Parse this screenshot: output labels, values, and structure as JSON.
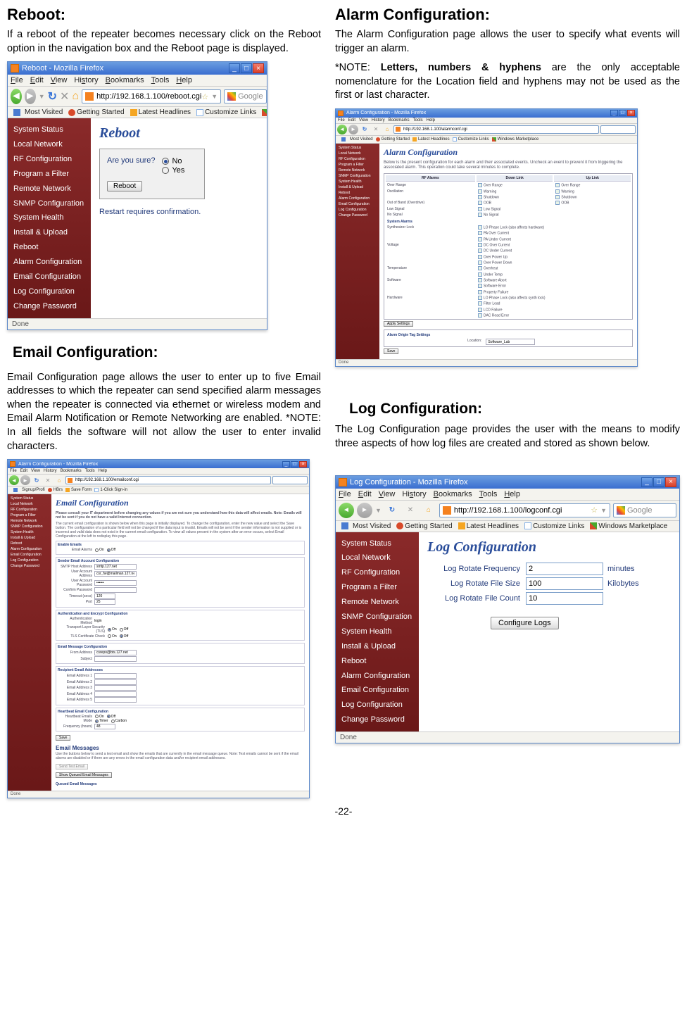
{
  "pageNumber": "-22-",
  "reboot": {
    "heading": "Reboot:",
    "text": "If a reboot of the repeater becomes necessary click on the Reboot option in the navigation box and the Reboot page is displayed.",
    "window": {
      "title": "Reboot - Mozilla Firefox",
      "url": "http://192.168.1.100/reboot.cgi",
      "search": "Google",
      "status": "Done",
      "appHeading": "Reboot",
      "question": "Are you sure?",
      "optNo": "No",
      "optYes": "Yes",
      "button": "Reboot",
      "confirm": "Restart requires confirmation."
    }
  },
  "alarm": {
    "heading": "Alarm Configuration:",
    "text": "The Alarm Configuration page allows the user to specify what events will trigger an alarm.",
    "notePrefix": "*NOTE:  ",
    "noteBold": "Letters, numbers & hyphens",
    "noteRest": " are the only acceptable nomenclature for the Location field and hyphens may not be used as the first or last character.",
    "window": {
      "title": "Alarm Configuration - Mozilla Firefox",
      "url": "http://192.168.1.100/alarmconf.cgi",
      "appHeading": "Alarm Configuration",
      "intro": "Below is the present configuration for each alarm and their associated events. Uncheck an event to prevent it from triggering the associated alarm. This operation could take several minutes to complete.",
      "colAlarm": "RF Alarms",
      "colDown": "Down Link",
      "colUp": "Up Link",
      "rows": {
        "overRange": "Over Range",
        "overRangeA": "Over Range",
        "overRangeB": "Over Range",
        "oscillation": "Oscillation",
        "oscillationA": "Warning",
        "oscillationB": "Warning",
        "oscillationC": "Shutdown",
        "oscillationD": "Shutdown",
        "outOfBand": "Out of Band (Overdrive)",
        "outOfBandA": "OOB",
        "outOfBandB": "OOB",
        "lowSignal": "Low Signal",
        "lowSignalA": "Low Signal",
        "noSignal": "No Signal",
        "noSignalA": "No Signal",
        "sysAlarms": "System Alarms",
        "synthLock": "Synthesizer Lock",
        "synth1": "LO Phase Lock (also affects hardware)",
        "synth2": "PA Over Current",
        "synth3": "PA Under Current",
        "voltage": "Voltage",
        "volt1": "DC Over Current",
        "volt2": "DC Under Current",
        "volt3": "Over Power Up",
        "volt4": "Over Power Down",
        "temperature": "Temperature",
        "temp1": "Overheat",
        "temp2": "Under Temp",
        "software": "Software",
        "soft1": "Software Abort",
        "soft2": "Software Error",
        "soft3": "Property Failure",
        "hardware": "Hardware",
        "hw1": "LO Phase Lock (also affects synth lock)",
        "hw2": "Filter Load",
        "hw3": "LCD Failure",
        "hw4": "DAC Read Error"
      },
      "applyBtn": "Apply Settings",
      "originTitle": "Alarm Origin Tag Settings",
      "locationLabel": "Location:",
      "locationValue": "Software_Lab",
      "saveBtn": "Save",
      "status": "Done"
    }
  },
  "email": {
    "heading": "Email Configuration:",
    "text": "Email Configuration page allows the user to enter up to five Email addresses to which the repeater can send specified alarm messages when the repeater is connected via ethernet or wireless modem and Email Alarm Notification or Remote Networking are enabled.  *NOTE: In all fields the software will not allow the user to enter invalid characters.",
    "window": {
      "title": "Alarm Configuration - Mozilla Firefox",
      "url": "http://192.168.1.100/emailconf.cgi",
      "appHeading": "Email Configuration",
      "desc1": "Please consult your IT department before changing any values if you are not sure you understand how this data will affect emails.  Note: Emails will not be sent if you do not have a valid Internet connection.",
      "desc2": "The current email configuration is shown below when this page is initially displayed. To change the configuration, enter the new value and select the Save button. The configuration of a particular field will not be changed if the data input is invalid. Emails will not be sent if the sender information is not supplied or is incorrect and valid data does not exist in the current email configuration. To view all values present in the system after an error occurs, select Email Configuration at the left to redisplay this page.",
      "enableTitle": "Enable Emails",
      "enableLabel": "Email Alarms",
      "on": "On",
      "off": "Off",
      "senderTitle": "Sender Email Account Configuration",
      "smtpLabel": "SMTP Host Address",
      "smtpVal": "smtp.127.net",
      "userLabel": "User Account Address",
      "userVal": "csr_fw@mailman.127.net",
      "passLabel": "User Account Password",
      "passVal": "••••••",
      "confirmLabel": "Confirm Password",
      "timeoutLabel": "Timeout (secs)",
      "timeoutVal": "120",
      "portLabel": "Port",
      "portVal": "25",
      "authTitle": "Authentication and Encrypt Configuration",
      "authMethodLabel": "Authentication Method",
      "authMethodVal": "login",
      "tlsLabel": "Transport Layer Security (TLS)",
      "certLabel": "TLS Certificate Check",
      "msgTitle": "Email Message Configuration",
      "fromLabel": "From Address",
      "fromVal": "csrepo@bts.127.net",
      "subjectLabel": "Subject",
      "recipTitle": "Recipient Email Addresses",
      "r1": "Email Address 1",
      "r2": "Email Address 2",
      "r3": "Email Address 3",
      "r4": "Email Address 4",
      "r5": "Email Address 5",
      "heartbeatTitle": "Heartbeat Email Configuration",
      "hbEnableLabel": "Heartbeat Emails",
      "hbModeLabel": "Mode",
      "hbTimer": "Timer",
      "hbCarbon": "Carbon",
      "hbFreqLabel": "Frequency (hours)",
      "hbFreqVal": "48",
      "saveBtn": "Save",
      "msgsTitle": "Email Messages",
      "msgsDesc": "Use the buttons below to send a test email and show the emails that are currently in the email message queue. Note: Test emails cannot be sent if the email alarms are disabled or if there are any errors in the email configuration data and/or recipient email addresses.",
      "sendTestBtn": "Send Test Email",
      "showQueueBtn": "Show Queued Email Messages",
      "queuedTitle": "Queued Email Messages",
      "status": "Done"
    }
  },
  "log": {
    "heading": "Log Configuration:",
    "text": "The Log Configuration page provides the user with the means to modify three aspects of how log files are created and stored as shown below.",
    "window": {
      "title": "Log Configuration - Mozilla Firefox",
      "url": "http://192.168.1.100/logconf.cgi",
      "appHeading": "Log Configuration",
      "freqLabel": "Log Rotate Frequency",
      "freqVal": "2",
      "freqUnit": "minutes",
      "sizeLabel": "Log Rotate File Size",
      "sizeVal": "100",
      "sizeUnit": "Kilobytes",
      "countLabel": "Log Rotate File Count",
      "countVal": "10",
      "button": "Configure Logs",
      "status": "Done"
    }
  },
  "menu": {
    "file": "File",
    "edit": "Edit",
    "view": "View",
    "history": "History",
    "bookmarks": "Bookmarks",
    "tools": "Tools",
    "help": "Help"
  },
  "bookmarks": {
    "most": "Most Visited",
    "start": "Getting Started",
    "latest": "Latest Headlines",
    "custom": "Customize Links",
    "market": "Windows Marketplace"
  },
  "bookmarksAlt": {
    "signup": "Signup/Profi",
    "hbr": "HBrs",
    "savef": "Save Form",
    "click": "1-Click Sign-in"
  },
  "sidebar": {
    "items": [
      "System Status",
      "Local Network",
      "RF Configuration",
      "Program a Filter",
      "Remote Network",
      "SNMP Configuration",
      "System Health",
      "Install & Upload",
      "Reboot",
      "Alarm Configuration",
      "Email Configuration",
      "Log Configuration",
      "Change Password"
    ]
  }
}
